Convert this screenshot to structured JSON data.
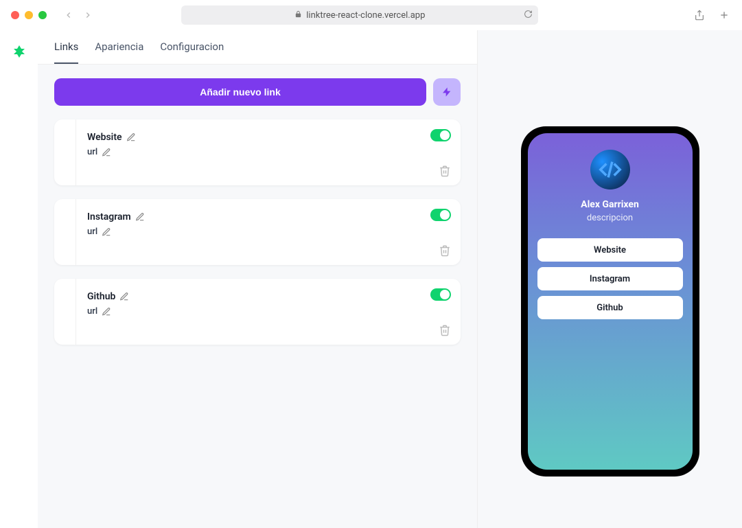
{
  "browser": {
    "url": "linktree-react-clone.vercel.app"
  },
  "tabs": [
    {
      "label": "Links",
      "active": true
    },
    {
      "label": "Apariencia",
      "active": false
    },
    {
      "label": "Configuracion",
      "active": false
    }
  ],
  "add_button": "Añadir nuevo link",
  "links": [
    {
      "title": "Website",
      "url_label": "url",
      "enabled": true
    },
    {
      "title": "Instagram",
      "url_label": "url",
      "enabled": true
    },
    {
      "title": "Github",
      "url_label": "url",
      "enabled": true
    }
  ],
  "preview": {
    "name": "Alex Garrixen",
    "description": "descripcion",
    "links": [
      "Website",
      "Instagram",
      "Github"
    ]
  }
}
